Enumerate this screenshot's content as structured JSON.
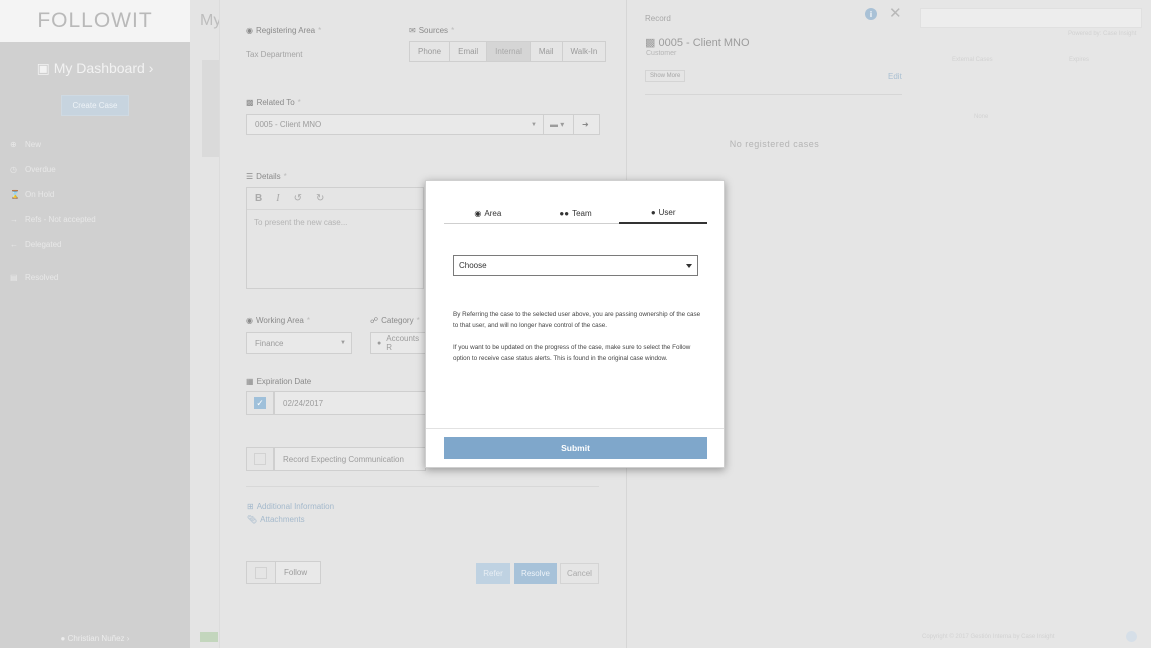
{
  "app": {
    "logo": "FOLLOWIT",
    "dashboard_label": "My Dashboard",
    "create_case_label": "Create Case",
    "page_title": "My",
    "user_name": "Christian Nuñez"
  },
  "sidebar": {
    "items": [
      {
        "label": "New",
        "icon": "plus-circle-icon"
      },
      {
        "label": "Overdue",
        "icon": "clock-icon"
      },
      {
        "label": "On Hold",
        "icon": "hourglass-icon"
      },
      {
        "label": "Refs - Not accepted",
        "icon": "arrow-right-icon"
      },
      {
        "label": "Delegated",
        "icon": "arrow-left-icon"
      },
      {
        "label": "Resolved",
        "icon": "archive-icon"
      }
    ]
  },
  "background": {
    "powered_by": "Powered by: Case Insight",
    "col_a": "External Cases",
    "col_b": "Expires",
    "none": "None",
    "footer": "Copyright © 2017 Gestión Interna by Case Insight"
  },
  "case_form": {
    "registering_area_label": "Registering Area",
    "registering_area_value": "Tax Department",
    "sources_label": "Sources",
    "sources": [
      "Phone",
      "Email",
      "Internal",
      "Mail",
      "Walk-In"
    ],
    "sources_active": "Internal",
    "related_to_label": "Related To",
    "related_to_value": "0005 - Client MNO",
    "details_label": "Details",
    "details_placeholder": "To present the new case...",
    "working_area_label": "Working Area",
    "working_area_value": "Finance",
    "category_label": "Category",
    "category_value": "Accounts R",
    "expiration_label": "Expiration Date",
    "expiration_value": "02/24/2017",
    "record_comm_label": "Record Expecting Communication",
    "additional_info_label": "Additional Information",
    "attachments_label": "Attachments",
    "follow_label": "Follow",
    "refer_label": "Refer",
    "resolve_label": "Resolve",
    "cancel_label": "Cancel"
  },
  "record": {
    "header": "Record",
    "client": "0005 - Client MNO",
    "client_type": "Customer",
    "show_more": "Show More",
    "edit": "Edit",
    "empty": "No registered cases"
  },
  "modal": {
    "tabs": [
      {
        "label": "Area",
        "icon": "cube-icon"
      },
      {
        "label": "Team",
        "icon": "users-icon"
      },
      {
        "label": "User",
        "icon": "user-icon"
      }
    ],
    "active_tab": "User",
    "select_value": "Choose",
    "notice_1": "By Referring the case to the selected user above, you are passing ownership of the case to that user, and will no longer have control of the case.",
    "notice_2": "If you want to be updated on the progress of the case, make sure to select the Follow option to receive case status alerts. This is found in the original case window.",
    "submit_label": "Submit"
  },
  "colors": {
    "accent": "#7fa7cb",
    "overlay_panel": "#e5e5e5"
  }
}
